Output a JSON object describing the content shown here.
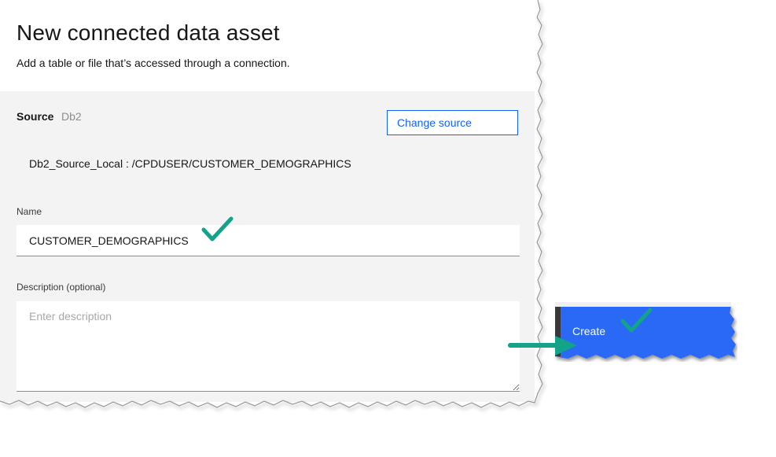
{
  "dialog": {
    "title": "New connected data asset",
    "subtitle": "Add a table or file that’s accessed through a connection."
  },
  "source": {
    "label": "Source",
    "value": "Db2",
    "change_label": "Change source",
    "path": "Db2_Source_Local : /CPDUSER/CUSTOMER_DEMOGRAPHICS"
  },
  "name_field": {
    "label": "Name",
    "value": "CUSTOMER_DEMOGRAPHICS"
  },
  "description_field": {
    "label": "Description (optional)",
    "placeholder": "Enter description"
  },
  "actions": {
    "create_label": "Create"
  },
  "colors": {
    "accent": "#0f62fe",
    "create_button": "#2b67f6",
    "annotation_green": "#13a388",
    "panel_gray": "#f3f3f3"
  },
  "icons": {
    "annotation_check": "checkmark-icon",
    "annotation_arrow": "arrow-right-icon"
  }
}
